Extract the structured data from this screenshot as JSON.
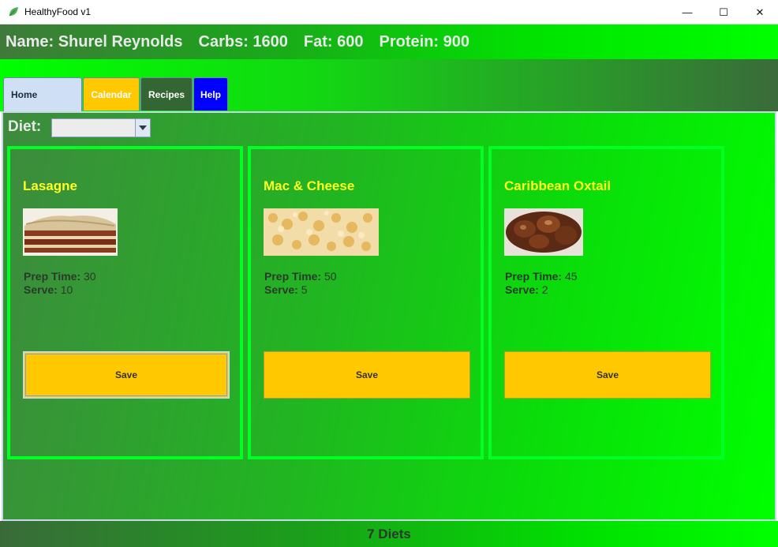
{
  "window": {
    "title": "HealthyFood v1",
    "minimize_glyph": "—",
    "maximize_glyph": "☐",
    "close_glyph": "✕"
  },
  "header": {
    "name": "Name: Shurel Reynolds",
    "carbs": "Carbs: 1600",
    "fat": "Fat: 600",
    "protein": "Protein: 900"
  },
  "tabs": [
    {
      "label": "Home",
      "color": "#cfe0f4",
      "selected": true
    },
    {
      "label": "Calendar",
      "color": "#ffc800"
    },
    {
      "label": "Recipes",
      "color": "#336633"
    },
    {
      "label": "Help",
      "color": "#0000ff"
    }
  ],
  "diet": {
    "label": "Diet:",
    "selected": ""
  },
  "recipes": [
    {
      "name": "Lasagne",
      "prep_label": "Prep Time:",
      "prep": " 30",
      "serve_label": "Serve:",
      "serve": " 10",
      "save": "Save",
      "image": "lasagne-photo"
    },
    {
      "name": "Mac & Cheese",
      "prep_label": "Prep Time:",
      "prep": " 50",
      "serve_label": "Serve:",
      "serve": " 5",
      "save": "Save",
      "image": "mac-and-cheese-photo"
    },
    {
      "name": "Caribbean Oxtail",
      "prep_label": "Prep Time:",
      "prep": " 45",
      "serve_label": "Serve:",
      "serve": " 2",
      "save": "Save",
      "image": "oxtail-photo"
    }
  ],
  "footer": {
    "status": "7 Diets"
  },
  "colors": {
    "accent_yellow": "#ffc800",
    "card_border": "#00ff22",
    "recipe_title": "#ffff22"
  }
}
